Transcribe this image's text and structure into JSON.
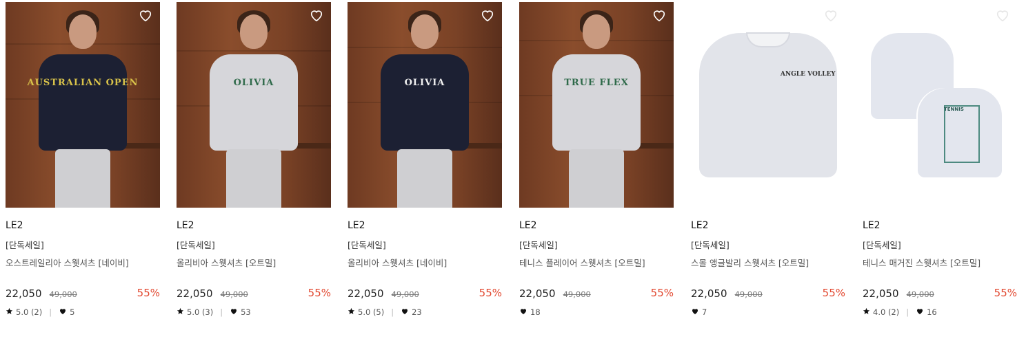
{
  "products": [
    {
      "brand": "LE2",
      "tag": "[단독세일]",
      "name": "오스트레일리아 스웻셔츠 [네이비]",
      "price": "22,050",
      "orig_price": "49,000",
      "discount": "55%",
      "rating": "5.0 (2)",
      "likes": "5",
      "image": "navy",
      "graphic": "AUSTRALIAN OPEN"
    },
    {
      "brand": "LE2",
      "tag": "[단독세일]",
      "name": "올리비아 스웻셔츠 [오트밀]",
      "price": "22,050",
      "orig_price": "49,000",
      "discount": "55%",
      "rating": "5.0 (3)",
      "likes": "53",
      "image": "oat",
      "graphic": "OLIVIA"
    },
    {
      "brand": "LE2",
      "tag": "[단독세일]",
      "name": "올리비아 스웻셔츠 [네이비]",
      "price": "22,050",
      "orig_price": "49,000",
      "discount": "55%",
      "rating": "5.0 (5)",
      "likes": "23",
      "image": "navy",
      "graphic": "OLIVIA"
    },
    {
      "brand": "LE2",
      "tag": "[단독세일]",
      "name": "테니스 플레이어 스웻셔츠 [오트밀]",
      "price": "22,050",
      "orig_price": "49,000",
      "discount": "55%",
      "rating": "",
      "likes": "18",
      "image": "oat",
      "graphic": "TRUE FLEX"
    },
    {
      "brand": "LE2",
      "tag": "[단독세일]",
      "name": "스몰 앵글발리 스웻셔츠 [오트밀]",
      "price": "22,050",
      "orig_price": "49,000",
      "discount": "55%",
      "rating": "",
      "likes": "7",
      "image": "flat",
      "graphic": "ANGLE VOLLEY"
    },
    {
      "brand": "LE2",
      "tag": "[단독세일]",
      "name": "테니스 매거진 스웻셔츠 [오트밀]",
      "price": "22,050",
      "orig_price": "49,000",
      "discount": "55%",
      "rating": "4.0 (2)",
      "likes": "16",
      "image": "flat2",
      "graphic": "TENNIS"
    }
  ],
  "colors": {
    "discount": "#e2472f",
    "text": "#222222"
  },
  "icons": {
    "wishlist": "heart-outline-icon",
    "rating": "star-icon",
    "likes": "heart-icon"
  }
}
